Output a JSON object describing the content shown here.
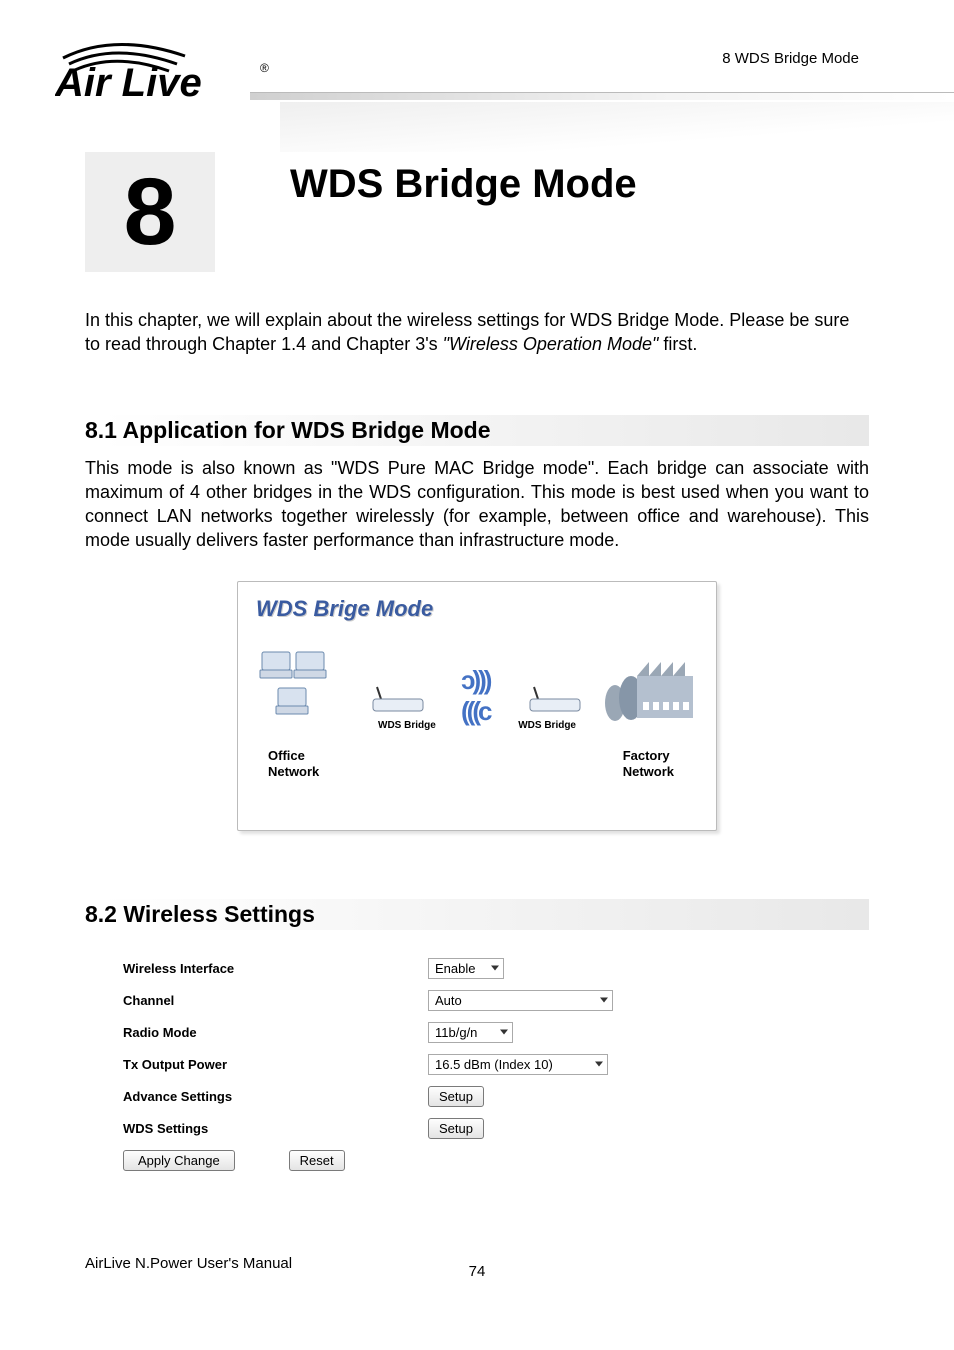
{
  "header": {
    "breadcrumb": "8 WDS Bridge Mode",
    "logo_alt": "AirLive"
  },
  "chapter": {
    "number": "8",
    "title": "WDS Bridge Mode"
  },
  "intro": {
    "text_prefix": "In this chapter, we will explain about the wireless settings for WDS Bridge Mode.    Please be sure to read through Chapter 1.4 and Chapter 3's ",
    "italic": "\"Wireless Operation Mode\"",
    "text_suffix": " first."
  },
  "section81": {
    "heading": "8.1 Application for WDS Bridge Mode",
    "para": "This mode is also known as \"WDS Pure MAC Bridge mode\".   Each bridge can associate with maximum of 4 other bridges in the WDS configuration.    This mode is best used when you want to connect LAN networks together wirelessly (for example, between office and warehouse).      This mode usually delivers faster performance than infrastructure mode."
  },
  "diagram": {
    "title": "WDS Brige Mode",
    "left_bridge": "WDS Bridge",
    "right_bridge": "WDS Bridge",
    "office_label_l1": "Office",
    "office_label_l2": "Network",
    "factory_label_l1": "Factory",
    "factory_label_l2": "Network"
  },
  "section82": {
    "heading": "8.2 Wireless Settings"
  },
  "settings": {
    "wireless_interface": {
      "label": "Wireless Interface",
      "value": "Enable"
    },
    "channel": {
      "label": "Channel",
      "value": "Auto"
    },
    "radio_mode": {
      "label": "Radio Mode",
      "value": "11b/g/n"
    },
    "tx_output_power": {
      "label": "Tx Output Power",
      "value": "16.5 dBm (Index 10)"
    },
    "advance_settings": {
      "label": "Advance Settings",
      "button": "Setup"
    },
    "wds_settings": {
      "label": "WDS Settings",
      "button": "Setup"
    },
    "apply_change": "Apply Change",
    "reset": "Reset"
  },
  "footer": {
    "manual": "AirLive N.Power User's Manual",
    "page": "74"
  }
}
